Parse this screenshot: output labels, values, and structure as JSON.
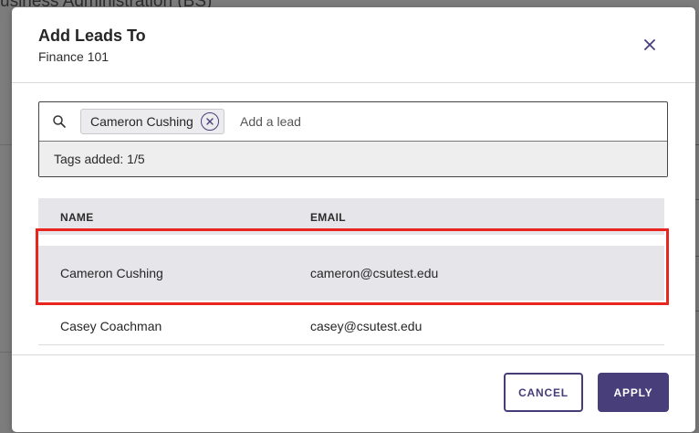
{
  "background": {
    "title": "usiness Administration (BS)"
  },
  "modal": {
    "title": "Add Leads To",
    "subtitle": "Finance 101"
  },
  "search": {
    "tags": [
      {
        "label": "Cameron Cushing"
      }
    ],
    "placeholder": "Add a lead",
    "status": "Tags added: 1/5"
  },
  "table": {
    "columns": [
      "NAME",
      "EMAIL"
    ],
    "rows": [
      {
        "name": "Cameron Cushing",
        "email": "cameron@csutest.edu",
        "selected": true
      },
      {
        "name": "Casey Coachman",
        "email": "casey@csutest.edu",
        "selected": false
      }
    ]
  },
  "footer": {
    "cancel_label": "CANCEL",
    "apply_label": "APPLY"
  },
  "colors": {
    "accent": "#483f7a",
    "highlight": "#e8261f",
    "selected_row": "#e6e5e9"
  },
  "icons": {
    "search": "search-icon",
    "close": "close-icon",
    "tag_remove": "remove-tag-icon"
  }
}
